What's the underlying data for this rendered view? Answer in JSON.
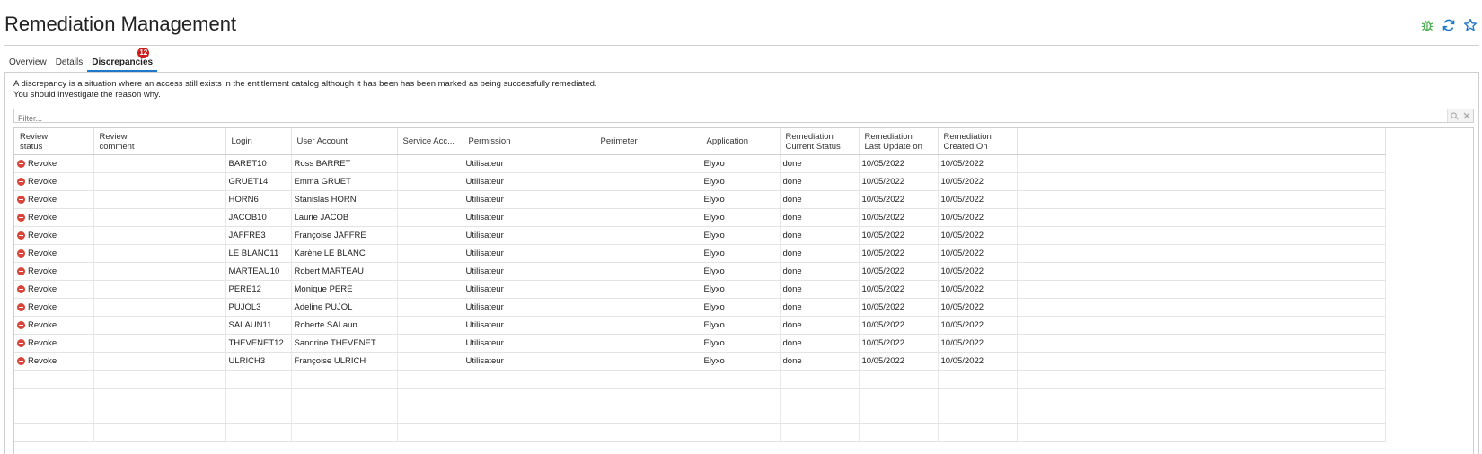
{
  "page": {
    "title": "Remediation Management"
  },
  "header_icons": [
    "bug-icon",
    "refresh-icon",
    "favorite-star-icon"
  ],
  "colors": {
    "accent": "#1f78c8",
    "badge": "#cc1d1d",
    "revoke": "#d9453a",
    "bug": "#4caf50"
  },
  "tabs": [
    {
      "label": "Overview",
      "active": false
    },
    {
      "label": "Details",
      "active": false
    },
    {
      "label": "Discrepancies",
      "active": true,
      "badge": "12"
    }
  ],
  "description": {
    "line1": "A discrepancy is a situation where an access still exists in the entitlement catalog although it has been has been marked as being successfully remediated.",
    "line2": "You should investigate the reason why."
  },
  "filter": {
    "placeholder": "Filter..."
  },
  "table": {
    "headers": [
      [
        "Review",
        "status"
      ],
      [
        "Review",
        "comment"
      ],
      [
        "Login"
      ],
      [
        "User Account"
      ],
      [
        "Service Acc..."
      ],
      [
        "Permission"
      ],
      [
        "Perimeter"
      ],
      [
        "Application"
      ],
      [
        "Remediation",
        "Current Status"
      ],
      [
        "Remediation",
        "Last Update on"
      ],
      [
        "Remediation",
        "Created On"
      ],
      [
        ""
      ]
    ],
    "rows": [
      [
        "Revoke",
        "",
        "BARET10",
        "Ross BARRET",
        "",
        "Utilisateur",
        "",
        "Elyxo",
        "done",
        "10/05/2022",
        "10/05/2022"
      ],
      [
        "Revoke",
        "",
        "GRUET14",
        "Emma GRUET",
        "",
        "Utilisateur",
        "",
        "Elyxo",
        "done",
        "10/05/2022",
        "10/05/2022"
      ],
      [
        "Revoke",
        "",
        "HORN6",
        "Stanislas HORN",
        "",
        "Utilisateur",
        "",
        "Elyxo",
        "done",
        "10/05/2022",
        "10/05/2022"
      ],
      [
        "Revoke",
        "",
        "JACOB10",
        "Laurie JACOB",
        "",
        "Utilisateur",
        "",
        "Elyxo",
        "done",
        "10/05/2022",
        "10/05/2022"
      ],
      [
        "Revoke",
        "",
        "JAFFRE3",
        "Françoise JAFFRE",
        "",
        "Utilisateur",
        "",
        "Elyxo",
        "done",
        "10/05/2022",
        "10/05/2022"
      ],
      [
        "Revoke",
        "",
        "LE BLANC11",
        "Karène LE BLANC",
        "",
        "Utilisateur",
        "",
        "Elyxo",
        "done",
        "10/05/2022",
        "10/05/2022"
      ],
      [
        "Revoke",
        "",
        "MARTEAU10",
        "Robert MARTEAU",
        "",
        "Utilisateur",
        "",
        "Elyxo",
        "done",
        "10/05/2022",
        "10/05/2022"
      ],
      [
        "Revoke",
        "",
        "PERE12",
        "Monique PERE",
        "",
        "Utilisateur",
        "",
        "Elyxo",
        "done",
        "10/05/2022",
        "10/05/2022"
      ],
      [
        "Revoke",
        "",
        "PUJOL3",
        "Adeline PUJOL",
        "",
        "Utilisateur",
        "",
        "Elyxo",
        "done",
        "10/05/2022",
        "10/05/2022"
      ],
      [
        "Revoke",
        "",
        "SALAUN11",
        "Roberte SALaun",
        "",
        "Utilisateur",
        "",
        "Elyxo",
        "done",
        "10/05/2022",
        "10/05/2022"
      ],
      [
        "Revoke",
        "",
        "THEVENET12",
        "Sandrine THEVENET",
        "",
        "Utilisateur",
        "",
        "Elyxo",
        "done",
        "10/05/2022",
        "10/05/2022"
      ],
      [
        "Revoke",
        "",
        "ULRICH3",
        "Françoise ULRICH",
        "",
        "Utilisateur",
        "",
        "Elyxo",
        "done",
        "10/05/2022",
        "10/05/2022"
      ]
    ]
  }
}
